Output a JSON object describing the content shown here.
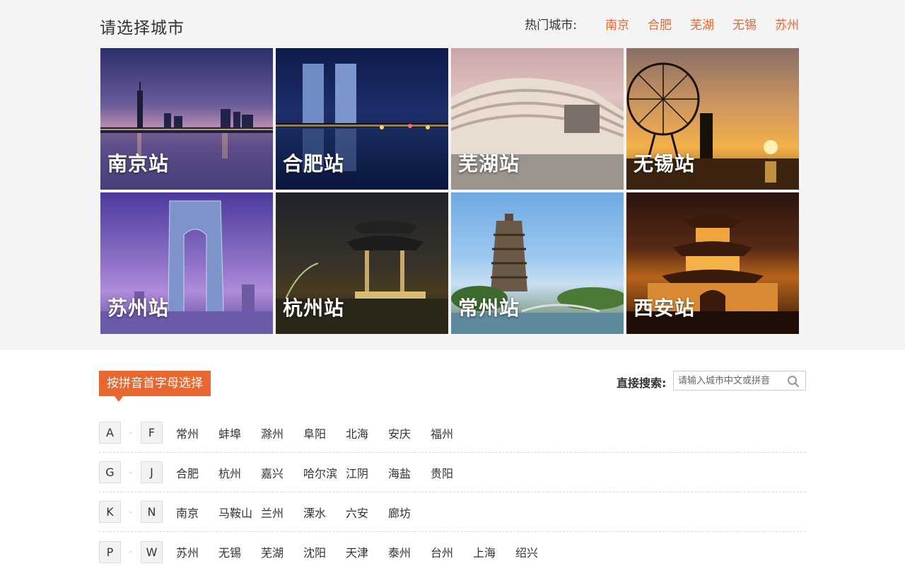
{
  "header": {
    "title": "请选择城市",
    "hot_label": "热门城市:",
    "hot_cities": [
      "南京",
      "合肥",
      "芜湖",
      "无锡",
      "苏州"
    ]
  },
  "stations": [
    {
      "name": "南京站"
    },
    {
      "name": "合肥站"
    },
    {
      "name": "芜湖站"
    },
    {
      "name": "无锡站"
    },
    {
      "name": "苏州站"
    },
    {
      "name": "杭州站"
    },
    {
      "name": "常州站"
    },
    {
      "name": "西安站"
    }
  ],
  "pinyin": {
    "badge": "按拼音首字母选择",
    "search_label": "直接搜索:",
    "search_placeholder": "请输入城市中文或拼音",
    "groups": [
      {
        "from": "A",
        "to": "F",
        "cities": [
          "常州",
          "蚌埠",
          "滁州",
          "阜阳",
          "北海",
          "安庆",
          "福州"
        ]
      },
      {
        "from": "G",
        "to": "J",
        "cities": [
          "合肥",
          "杭州",
          "嘉兴",
          "哈尔滨",
          "江阴",
          "海盐",
          "贵阳"
        ]
      },
      {
        "from": "K",
        "to": "N",
        "cities": [
          "南京",
          "马鞍山",
          "兰州",
          "溧水",
          "六安",
          "廊坊"
        ]
      },
      {
        "from": "P",
        "to": "W",
        "cities": [
          "苏州",
          "无锡",
          "芜湖",
          "沈阳",
          "天津",
          "泰州",
          "台州",
          "上海",
          "绍兴"
        ]
      }
    ]
  },
  "colors": {
    "accent": "#e8662f",
    "top_background": "#f4f4f4"
  }
}
